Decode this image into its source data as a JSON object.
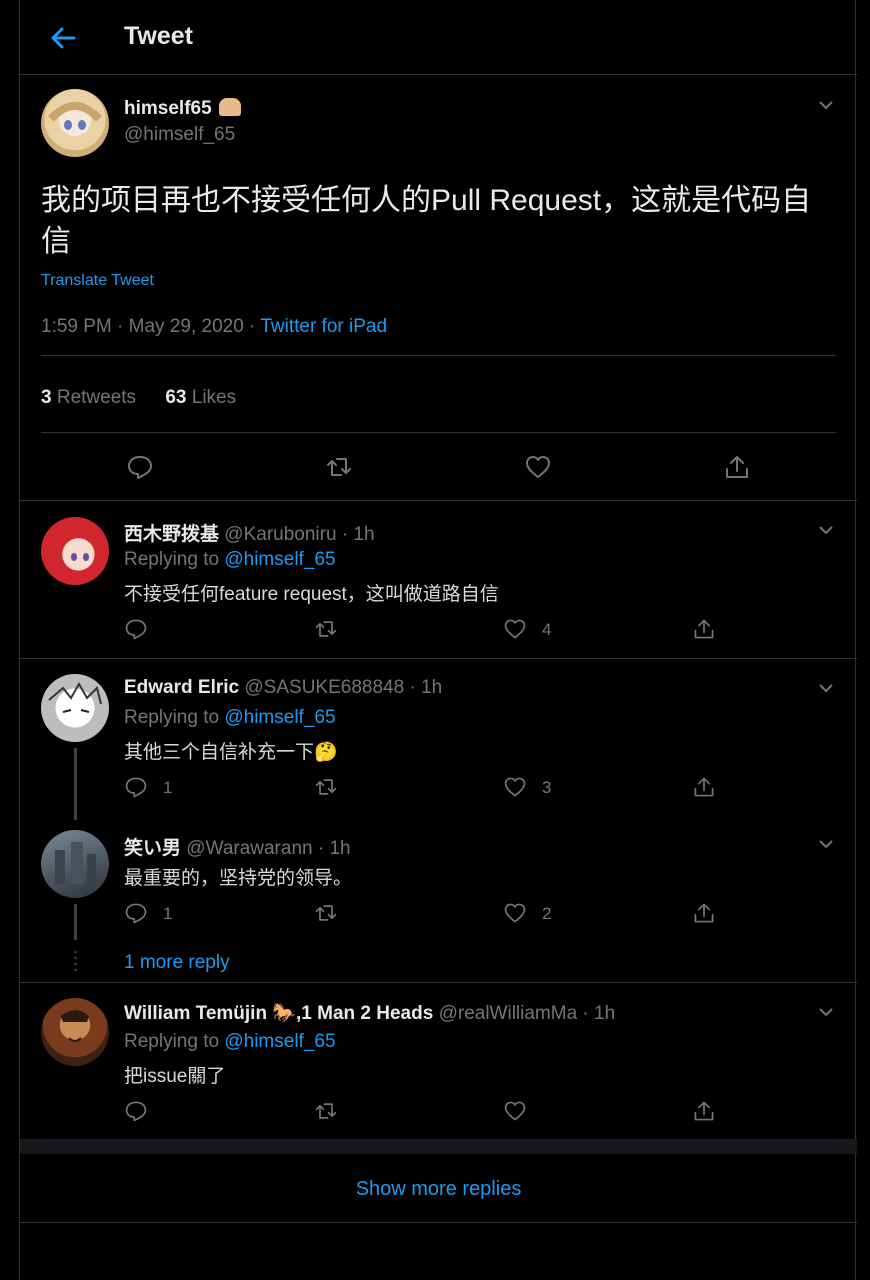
{
  "header": {
    "title": "Tweet"
  },
  "main_tweet": {
    "display_name": "himself65",
    "handle": "@himself_65",
    "text": "我的项目再也不接受任何人的Pull Request，这就是代码自信",
    "translate": "Translate Tweet",
    "time": "1:59 PM · May 29, 2020 · ",
    "source": "Twitter for iPad",
    "retweet_count": "3",
    "retweet_label": " Retweets",
    "like_count": "63",
    "like_label": " Likes"
  },
  "replies": [
    {
      "display_name": "西木野拨基",
      "meta": "@Karuboniru · 1h",
      "replying_prefix": "Replying to ",
      "replying_to": "@himself_65",
      "text": "不接受任何feature request，这叫做道路自信",
      "reply_count": "",
      "like_count": "4"
    },
    {
      "display_name": "Edward Elric",
      "meta": "@SASUKE688848 · 1h",
      "replying_prefix": "Replying to ",
      "replying_to": "@himself_65",
      "text": "其他三个自信补充一下",
      "emoji": "🤔",
      "reply_count": "1",
      "like_count": "3"
    },
    {
      "display_name": "笑い男",
      "meta": "@Warawarann · 1h",
      "text": "最重要的，坚持党的领导。",
      "reply_count": "1",
      "like_count": "2"
    },
    {
      "display_name": "William Temüjin",
      "name_emoji": "🐎",
      "name_suffix": ",1 Man 2 Heads",
      "meta": "@realWilliamMa · 1h",
      "replying_prefix": "Replying to ",
      "replying_to": "@himself_65",
      "text": "把issue關了",
      "reply_count": "",
      "like_count": ""
    }
  ],
  "more_reply": "1 more reply",
  "show_more": "Show more replies",
  "icons": {
    "back": "arrow-left-icon",
    "reply": "speech-bubble-icon",
    "retweet": "retweet-icon",
    "like": "heart-icon",
    "share": "share-icon",
    "more": "chevron-down-icon"
  },
  "colors": {
    "accent": "#1d9bf0",
    "background": "#000000",
    "secondary_text": "#71767b",
    "border": "#2f3336"
  }
}
